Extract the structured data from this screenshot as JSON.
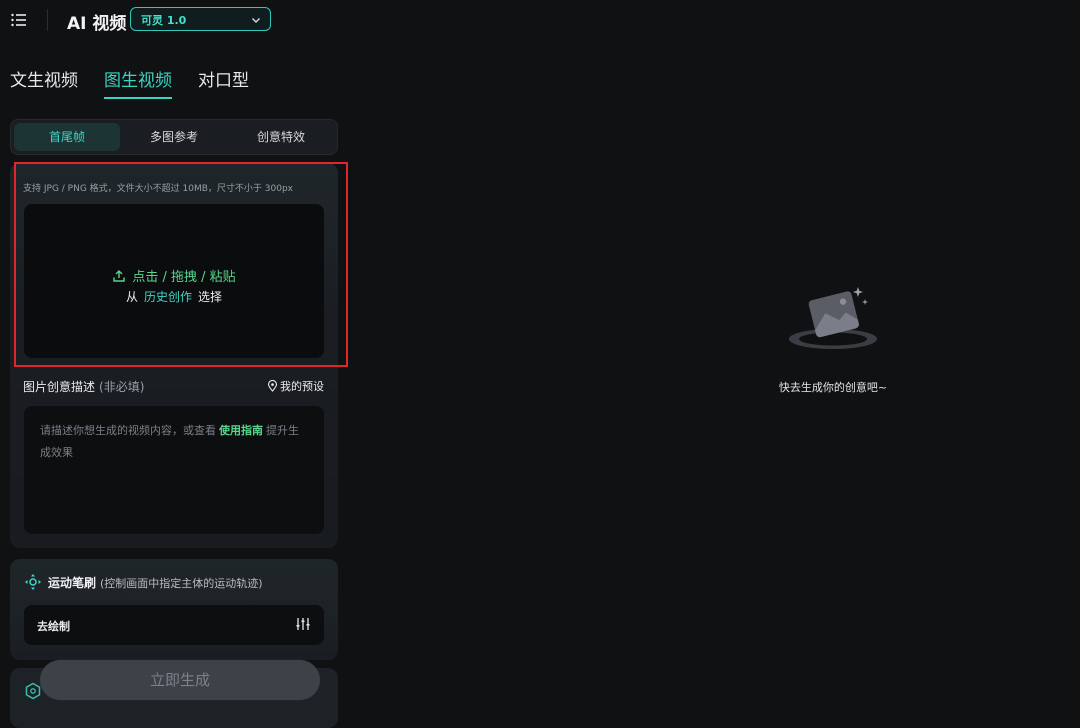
{
  "header": {
    "app_title": "AI 视频",
    "model_selector": "可灵 1.0"
  },
  "mode_tabs": [
    {
      "label": "文生视频",
      "active": false
    },
    {
      "label": "图生视频",
      "active": true
    },
    {
      "label": "对口型",
      "active": false
    }
  ],
  "sub_tabs": [
    {
      "label": "首尾帧",
      "active": true
    },
    {
      "label": "多图参考",
      "active": false
    },
    {
      "label": "创意特效",
      "active": false
    }
  ],
  "upload": {
    "hint": "支持 JPG / PNG 格式，文件大小不超过 10MB，尺寸不小于 300px",
    "action_text": "点击 / 拖拽 / 粘贴",
    "from_text": "从",
    "history_link": "历史创作",
    "select_text": "选择"
  },
  "description": {
    "label": "图片创意描述",
    "optional": "(非必填)",
    "preset_label": "我的预设",
    "placeholder_before": "请描述你想生成的视频内容，或查看",
    "guide_link": "使用指南",
    "placeholder_after": "提升生成效果"
  },
  "motion_brush": {
    "title": "运动笔刷",
    "subtitle": "(控制画面中指定主体的运动轨迹)",
    "draw_label": "去绘制"
  },
  "generate_button": "立即生成",
  "empty_state": {
    "text": "快去生成你的创意吧~"
  },
  "colors": {
    "accent": "#39d4c2",
    "upload_green": "#58d68d",
    "highlight_box": "#e2252b",
    "background": "#101113"
  }
}
